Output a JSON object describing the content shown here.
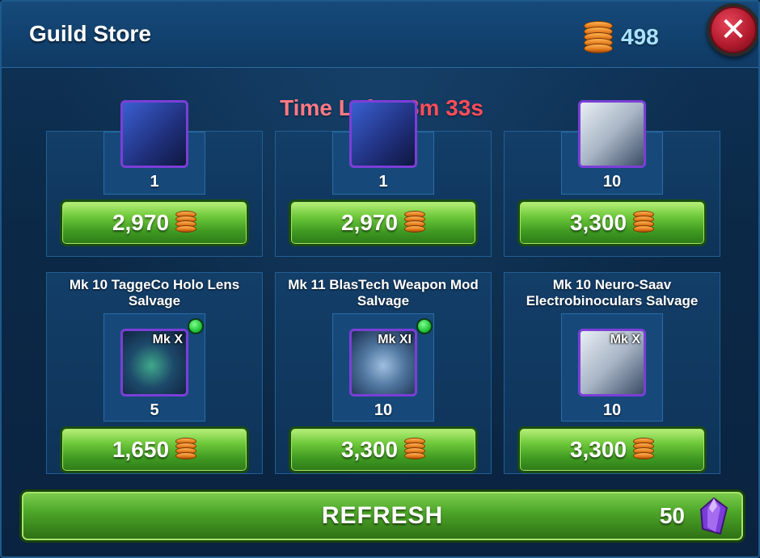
{
  "header": {
    "title": "Guild Store",
    "currency_amount": "498",
    "currency_icon": "guild-coin-icon",
    "close_icon": "close-icon"
  },
  "timer": {
    "label": "Time Left:",
    "value": "43m 33s"
  },
  "store_items": [
    {
      "name": "",
      "mk": "",
      "quantity": "1",
      "price": "2,970",
      "icon": "blueprint-icon",
      "is_new": false
    },
    {
      "name": "",
      "mk": "",
      "quantity": "1",
      "price": "2,970",
      "icon": "blueprint-icon",
      "is_new": false
    },
    {
      "name": "",
      "mk": "",
      "quantity": "10",
      "price": "3,300",
      "icon": "binoculars-icon",
      "is_new": false
    },
    {
      "name": "Mk 10 TaggeCo Holo Lens Salvage",
      "mk": "Mk X",
      "quantity": "5",
      "price": "1,650",
      "icon": "holo-lens-icon",
      "is_new": true
    },
    {
      "name": "Mk 11 BlasTech Weapon Mod Salvage",
      "mk": "Mk XI",
      "quantity": "10",
      "price": "3,300",
      "icon": "weapon-mod-icon",
      "is_new": true
    },
    {
      "name": "Mk 10 Neuro-Saav Electrobinoculars Salvage",
      "mk": "Mk X",
      "quantity": "10",
      "price": "3,300",
      "icon": "binoculars-icon",
      "is_new": false
    }
  ],
  "refresh": {
    "label": "REFRESH",
    "cost": "50",
    "cost_icon": "crystal-icon"
  },
  "colors": {
    "price_button": "#6ec83a",
    "timer_text": "#ff4d5c",
    "currency_text": "#a9e3ff",
    "item_border": "#7b3fd6"
  }
}
